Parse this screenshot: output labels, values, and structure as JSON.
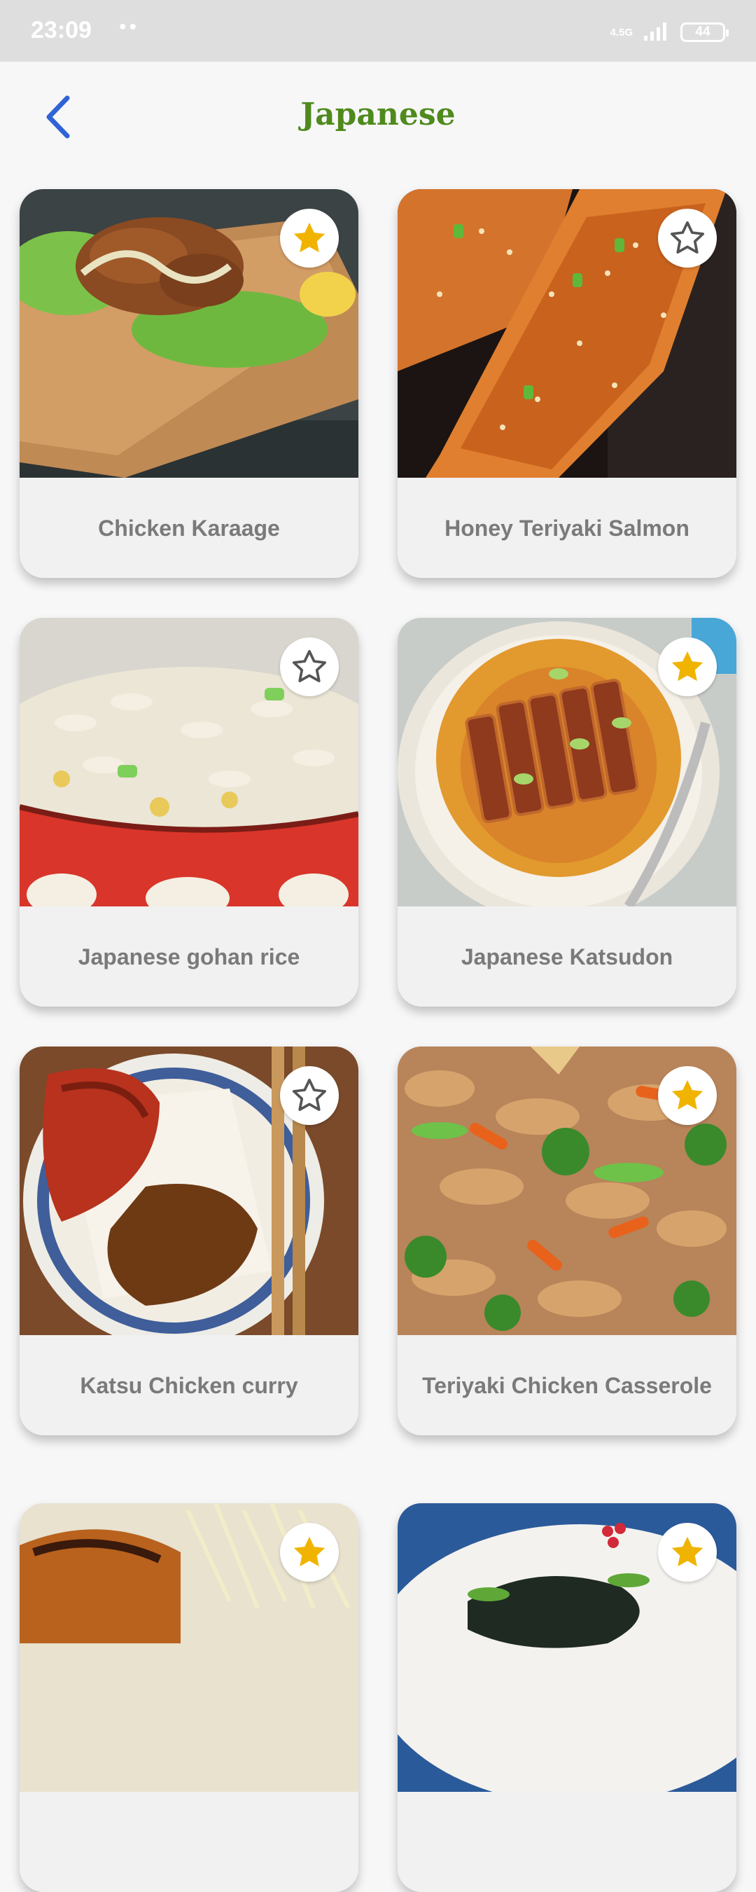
{
  "status_bar": {
    "time": "23:09",
    "dots": "••",
    "network": "4.5G",
    "battery": "44"
  },
  "header": {
    "title": "Japanese",
    "back_icon": "chevron-left-icon",
    "title_color": "#4f8a1c"
  },
  "colors": {
    "accent_blue": "#2f63d6",
    "favorite_star": "#f0b400",
    "star_outline": "#555555"
  },
  "recipes": [
    {
      "name": "Chicken Karaage",
      "favorite": true,
      "icon": "star-filled-icon"
    },
    {
      "name": "Honey Teriyaki Salmon",
      "favorite": false,
      "icon": "star-outline-icon"
    },
    {
      "name": "Japanese gohan rice",
      "favorite": false,
      "icon": "star-outline-icon"
    },
    {
      "name": "Japanese Katsudon",
      "favorite": true,
      "icon": "star-filled-icon"
    },
    {
      "name": "Katsu Chicken curry",
      "favorite": false,
      "icon": "star-outline-icon"
    },
    {
      "name": "Teriyaki Chicken Casserole",
      "favorite": true,
      "icon": "star-filled-icon"
    },
    {
      "name": "",
      "favorite": true,
      "icon": "star-filled-icon"
    },
    {
      "name": "",
      "favorite": true,
      "icon": "star-filled-icon"
    }
  ]
}
